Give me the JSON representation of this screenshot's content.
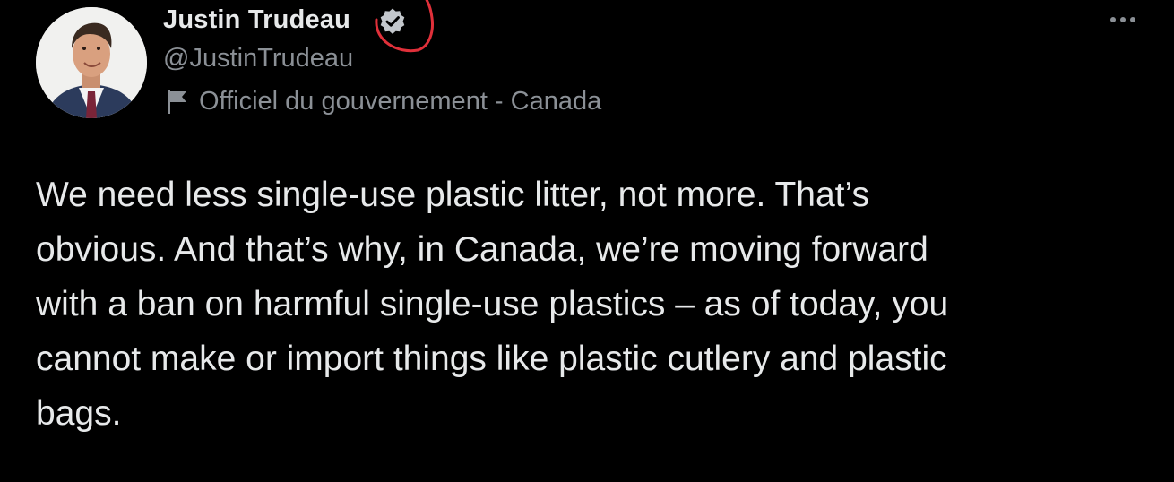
{
  "tweet": {
    "author": {
      "display_name": "Justin Trudeau",
      "handle": "@JustinTrudeau",
      "verified_icon": "verified-badge-icon",
      "label_icon": "flag-icon",
      "label": "Officiel du gouvernement - Canada"
    },
    "more_icon": "more-options-icon",
    "text": "We need less single-use plastic litter, not more. That’s\nobvious. And that’s why, in Canada, we’re moving forward\nwith a ban on harmful single-use plastics – as of today, you\ncannot make or import things like plastic cutlery and plastic\nbags."
  },
  "colors": {
    "background": "#000000",
    "primary_text": "#e7e9ea",
    "secondary_text": "#8b9096",
    "annotation": "#e0303a"
  }
}
